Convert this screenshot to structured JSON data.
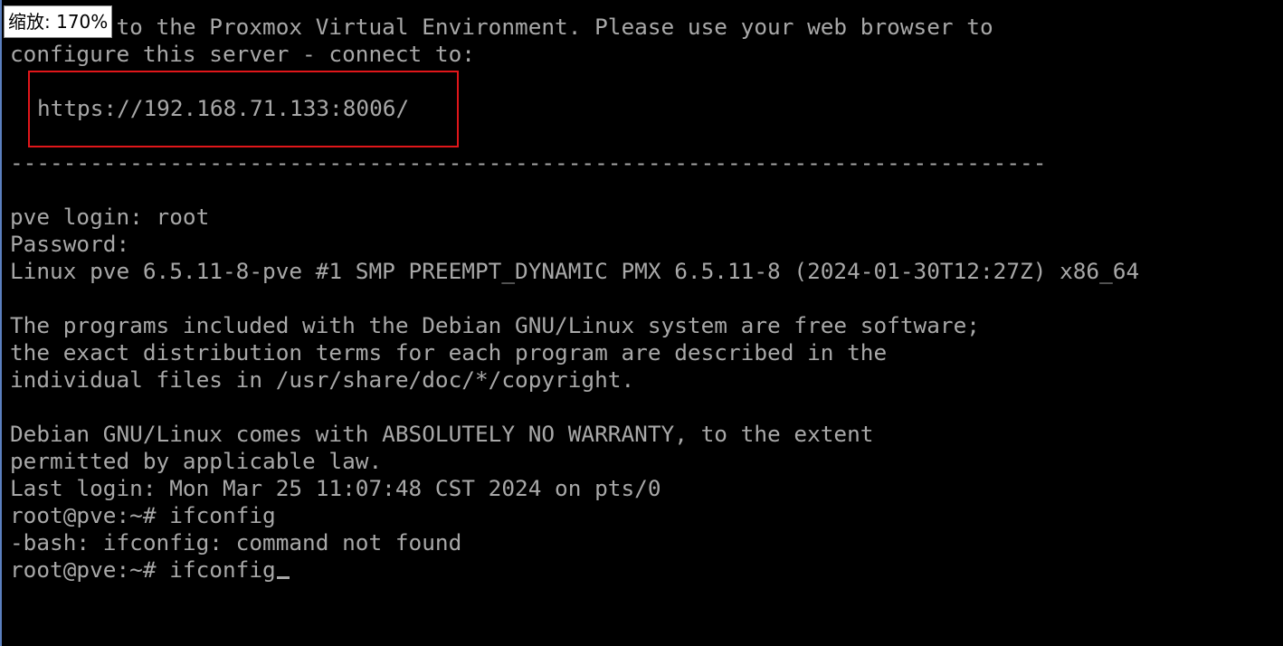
{
  "zoom_indicator": {
    "label": "缩放: 170%"
  },
  "terminal": {
    "banner_line_1": "Welcome to the Proxmox Virtual Environment. Please use your web browser to",
    "banner_line_2": "configure this server - connect to:",
    "url": "https://192.168.71.133:8006/",
    "separator": "------------------------------------------------------------------------------",
    "login_prompt": "pve login: root",
    "password_prompt": "Password:",
    "kernel_info": "Linux pve 6.5.11-8-pve #1 SMP PREEMPT_DYNAMIC PMX 6.5.11-8 (2024-01-30T12:27Z) x86_64",
    "notice_line_1": "The programs included with the Debian GNU/Linux system are free software;",
    "notice_line_2": "the exact distribution terms for each program are described in the",
    "notice_line_3": "individual files in /usr/share/doc/*/copyright.",
    "warranty_line_1": "Debian GNU/Linux comes with ABSOLUTELY NO WARRANTY, to the extent",
    "warranty_line_2": "permitted by applicable law.",
    "last_login": "Last login: Mon Mar 25 11:07:48 CST 2024 on pts/0",
    "command_1": "root@pve:~# ifconfig",
    "error_1": "-bash: ifconfig: command not found",
    "command_2": "root@pve:~# ifconfig"
  },
  "colors": {
    "background": "#000000",
    "text": "#a8a8a8",
    "highlight_box": "#e0161a"
  }
}
